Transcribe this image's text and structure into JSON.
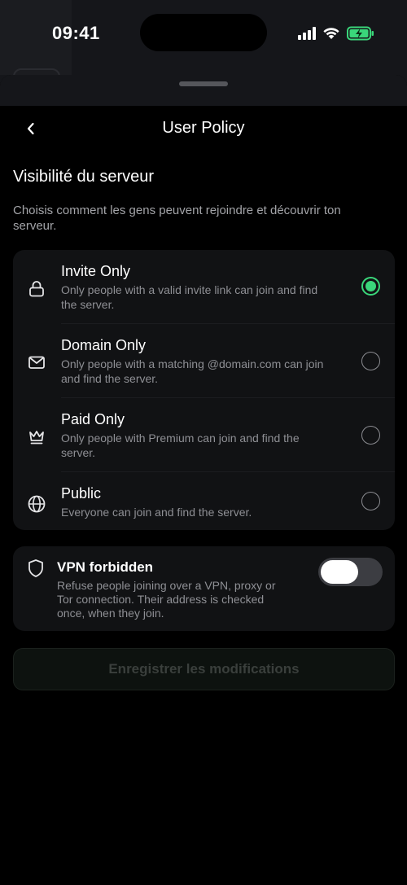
{
  "status_bar": {
    "time": "09:41"
  },
  "header": {
    "title": "User Policy",
    "back_icon": "chevron-left-icon"
  },
  "visibility": {
    "title": "Visibilité du serveur",
    "description": "Choisis comment les gens peuvent rejoindre et découvrir ton serveur.",
    "options": [
      {
        "icon": "lock-icon",
        "title": "Invite Only",
        "description": "Only people with a valid invite link can join and find the server.",
        "selected": true
      },
      {
        "icon": "envelope-icon",
        "title": "Domain Only",
        "description": "Only people with a matching @domain.com can join and find the server.",
        "selected": false
      },
      {
        "icon": "crown-icon",
        "title": "Paid Only",
        "description": "Only people with Premium can join and find the server.",
        "selected": false
      },
      {
        "icon": "globe-icon",
        "title": "Public",
        "description": "Everyone can join and find the server.",
        "selected": false
      }
    ]
  },
  "vpn": {
    "icon": "shield-icon",
    "title": "VPN forbidden",
    "description": "Refuse people joining over a VPN, proxy or Tor connection. Their address is checked once, when they join.",
    "enabled": false
  },
  "save_button": {
    "label": "Enregistrer les modifications",
    "disabled": true
  },
  "colors": {
    "accent": "#3ad67a",
    "background": "#000000",
    "card": "#111214",
    "battery": "#3ad67a"
  }
}
